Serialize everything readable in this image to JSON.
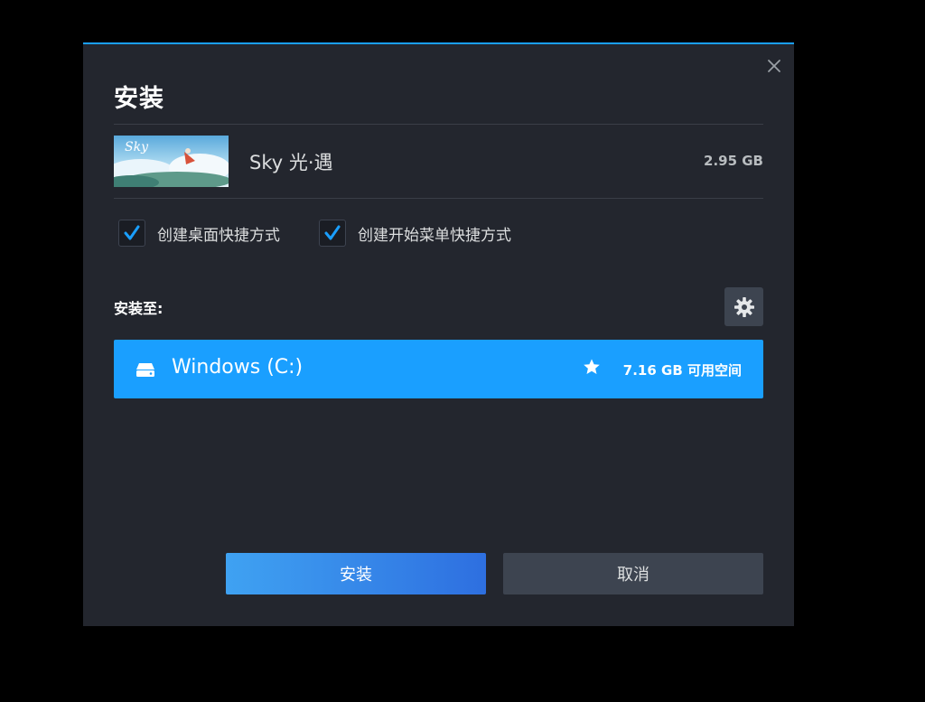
{
  "dialog": {
    "title": "安装",
    "accent_color": "#1a9fff"
  },
  "game": {
    "name": "Sky 光·遇",
    "size": "2.95 GB",
    "thumbnail_logo": "Sky"
  },
  "options": [
    {
      "label": "创建桌面快捷方式",
      "checked": true
    },
    {
      "label": "创建开始菜单快捷方式",
      "checked": true
    }
  ],
  "install_location": {
    "label": "安装至:",
    "drive": {
      "name": "Windows (C:)",
      "icon": "drive-icon",
      "favorite": true,
      "free_space": "7.16 GB 可用空间"
    }
  },
  "buttons": {
    "install_label": "安装",
    "cancel_label": "取消"
  }
}
